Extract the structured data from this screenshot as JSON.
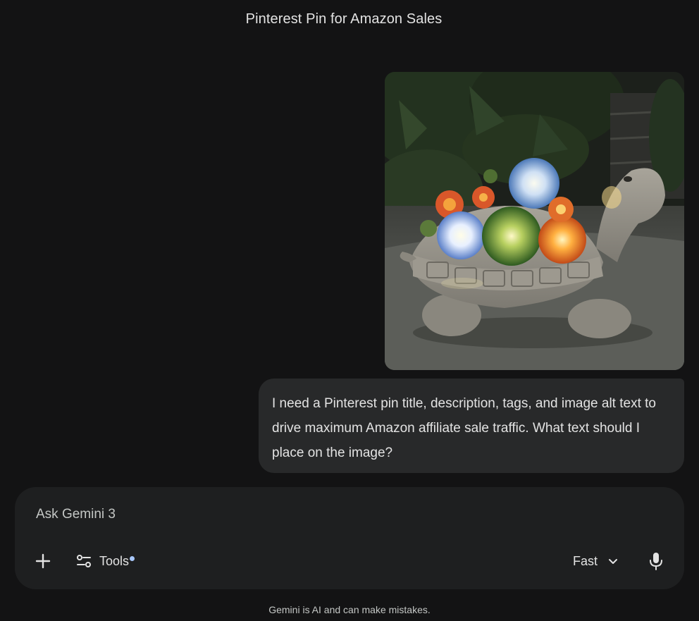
{
  "conversation": {
    "title": "Pinterest Pin for Amazon Sales"
  },
  "user_message": {
    "attachment": {
      "type": "image",
      "icon": "turtle-garden-statue-photo"
    },
    "text": "I need a Pinterest pin title, description, tags, and image alt text to drive maximum Amazon affiliate sale traffic. What text should I place on the image?"
  },
  "composer": {
    "placeholder": "Ask Gemini 3",
    "add_icon": "plus-icon",
    "tools_icon": "tune-icon",
    "tools_label": "Tools",
    "model_label": "Fast",
    "model_icon": "chevron-down-icon",
    "mic_icon": "microphone-icon"
  },
  "footer": {
    "disclaimer": "Gemini is AI and can make mistakes."
  },
  "colors": {
    "background": "#131314",
    "bubble": "#28292a",
    "composer": "#1e1f20",
    "text": "#e3e3e3",
    "accent_dot": "#a8c7fa"
  }
}
